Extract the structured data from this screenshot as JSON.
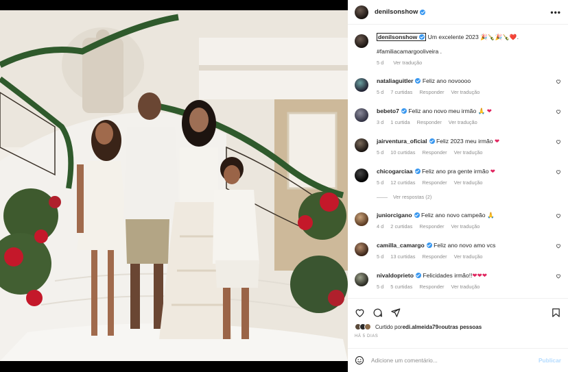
{
  "post": {
    "username": "denilsonshow",
    "more_glyph": "•••",
    "caption_text": " Um excelente 2023 🎉🍾🎉🍾❤️.",
    "hashtag": "#familiacamargooliveira .",
    "caption_time": "5 d",
    "caption_translate": "Ver tradução"
  },
  "comments": [
    {
      "user": "nataliaguitler",
      "text": "Feliz ano novoooo",
      "time": "5 d",
      "likes": "7 curtidas",
      "reply": "Responder",
      "translate": "Ver tradução"
    },
    {
      "user": "bebeto7",
      "text": "Feliz ano novo meu irmão 🙏",
      "heart": "❤",
      "time": "3 d",
      "likes": "1 curtida",
      "reply": "Responder",
      "translate": "Ver tradução"
    },
    {
      "user": "jairventura_oficial",
      "text": "Feliz 2023 meu irmão",
      "heart": "❤",
      "time": "5 d",
      "likes": "10 curtidas",
      "reply": "Responder",
      "translate": "Ver tradução"
    },
    {
      "user": "chicogarciaa",
      "text": "Feliz ano pra gente irmão",
      "heart": "❤",
      "time": "5 d",
      "likes": "12 curtidas",
      "reply": "Responder",
      "translate": "Ver tradução"
    },
    {
      "user": "juniorcigano",
      "text": "Feliz ano novo campeão 🙏",
      "time": "4 d",
      "likes": "2 curtidas",
      "reply": "Responder",
      "translate": "Ver tradução"
    },
    {
      "user": "camilla_camargo",
      "text": "Feliz ano novo amo vcs",
      "time": "5 d",
      "likes": "13 curtidas",
      "reply": "Responder",
      "translate": "Ver tradução"
    },
    {
      "user": "nivaldoprieto",
      "text": "Felicidades irmão!!",
      "heart": "❤❤❤",
      "time": "5 d",
      "likes": "5 curtidas",
      "reply": "Responder",
      "translate": "Ver tradução"
    }
  ],
  "view_replies": "Ver respostas (2)",
  "likes_line": {
    "prefix": "Curtido por ",
    "user": "edi.almeida79",
    "middle": " e ",
    "rest": "outras pessoas"
  },
  "time_ago": "HÁ 5 DIAS",
  "comment_box": {
    "placeholder": "Adicione um comentário...",
    "post_label": "Publicar"
  },
  "icons": {
    "verified": "verified-badge-icon",
    "like": "heart-icon",
    "comment": "comment-bubble-icon",
    "share": "paper-plane-icon",
    "save": "bookmark-icon",
    "emoji": "emoji-smiley-icon"
  },
  "colors": {
    "verified_blue": "#3897f0",
    "link_blue": "#00376b",
    "muted": "#8e8e8e",
    "post_disabled": "#b3dbff",
    "heart_red": "#e0245e"
  }
}
